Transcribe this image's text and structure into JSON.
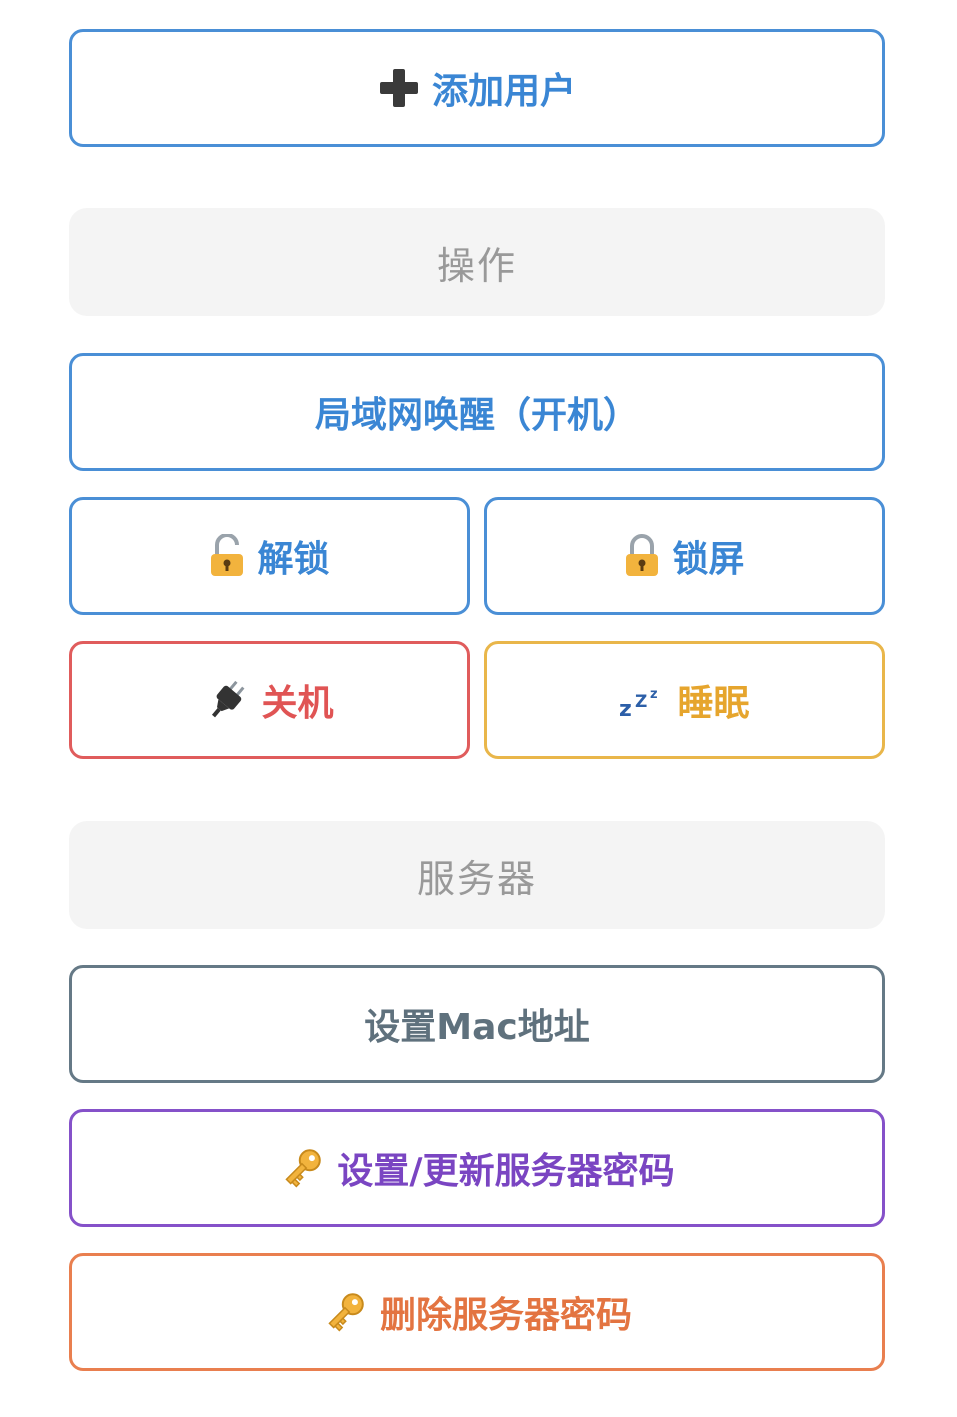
{
  "add_user": {
    "label": "添加用户",
    "icon": "plus-icon",
    "color": "#3a86d4"
  },
  "operations": {
    "header": "操作",
    "wake_label": "局域网唤醒（开机）",
    "unlock_label": "解锁",
    "lock_label": "锁屏",
    "shutdown_label": "关机",
    "sleep_label": "睡眠",
    "colors": {
      "blue": "#3a86d4",
      "red": "#e05454",
      "yellow": "#e6a52d"
    },
    "icons": {
      "unlock": "unlocked-padlock-icon",
      "lock": "locked-padlock-icon",
      "shutdown": "electric-plug-icon",
      "sleep": "zzz-sleep-icon"
    }
  },
  "server": {
    "header": "服务器",
    "set_mac_label": "设置Mac地址",
    "set_password_label": "设置/更新服务器密码",
    "delete_password_label": "删除服务器密码",
    "colors": {
      "slate": "#5f717d",
      "purple": "#7a45c2",
      "orange": "#e37441"
    },
    "icons": {
      "set_password": "key-icon",
      "delete_password": "key-icon"
    }
  }
}
